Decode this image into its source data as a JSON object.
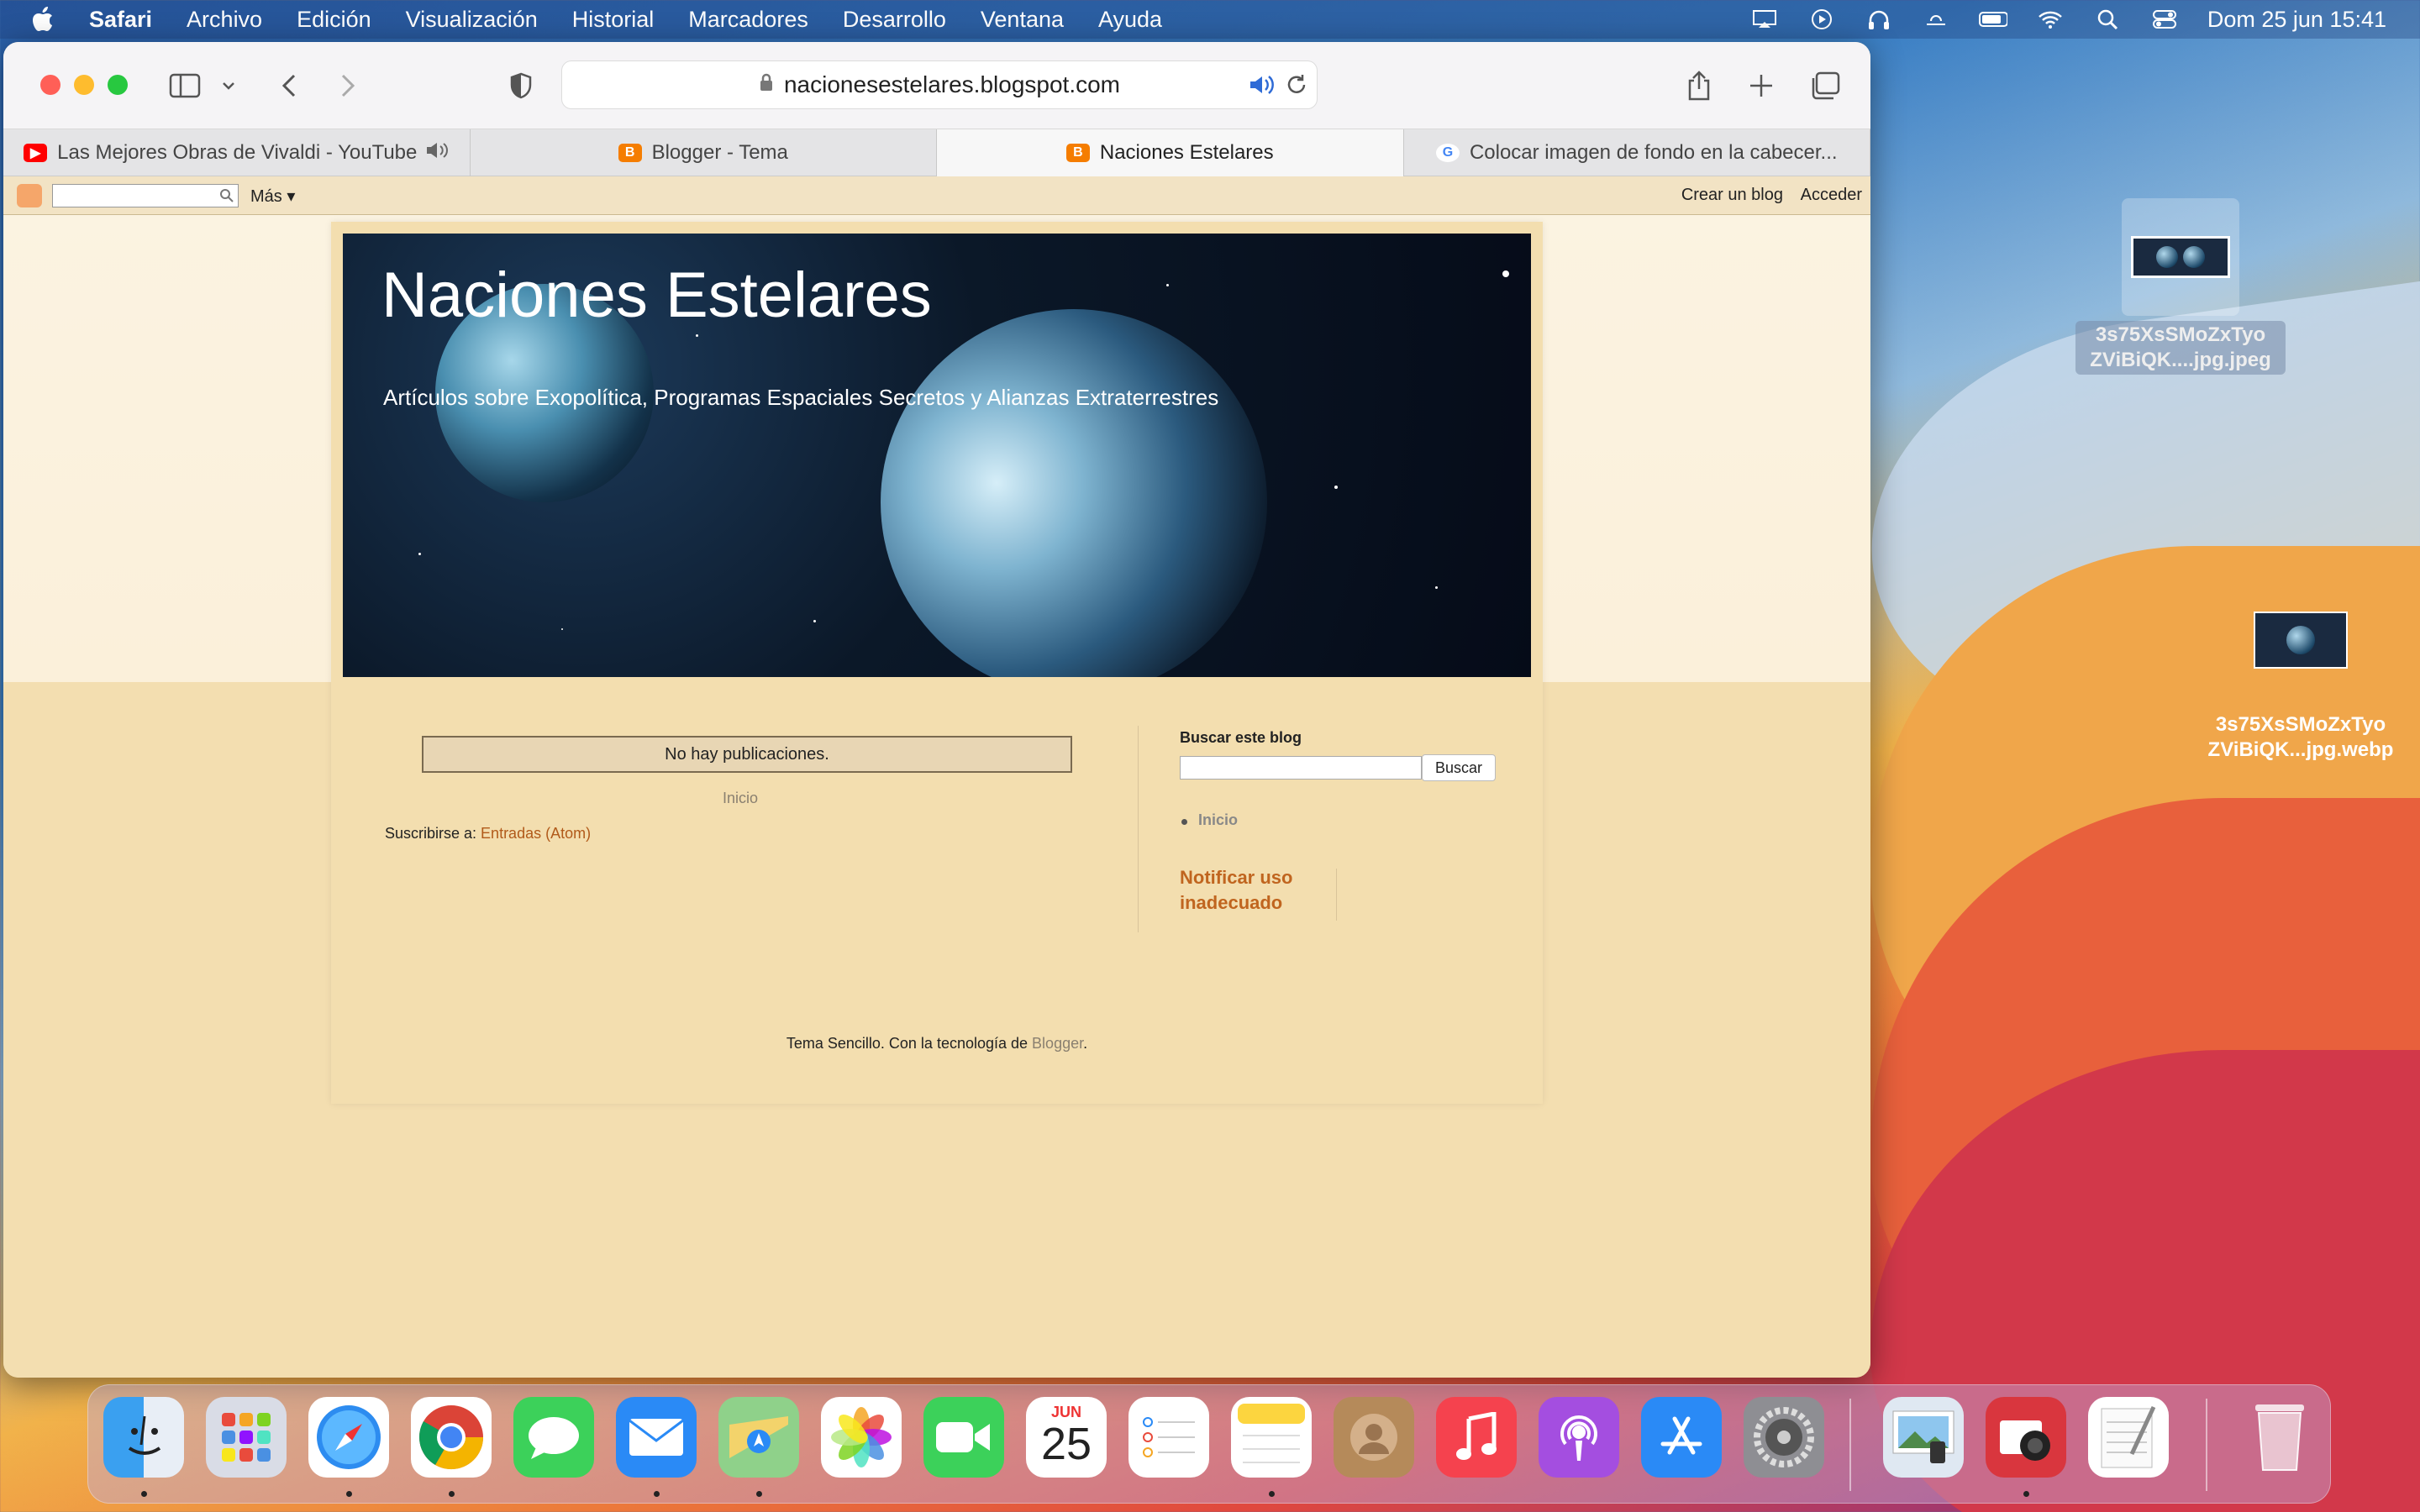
{
  "menubar": {
    "app_name": "Safari",
    "items": [
      "Archivo",
      "Edición",
      "Visualización",
      "Historial",
      "Marcadores",
      "Desarrollo",
      "Ventana",
      "Ayuda"
    ],
    "datetime": "Dom 25 jun 15:41"
  },
  "browser": {
    "url": "nacionesestelares.blogspot.com",
    "tabs": [
      {
        "title": "Las Mejores Obras de Vivaldi - YouTube",
        "favicon": "youtube-icon",
        "color": "#ff0000",
        "audio": true
      },
      {
        "title": "Blogger - Tema",
        "favicon": "blogger-icon",
        "color": "#f57d00"
      },
      {
        "title": "Naciones Estelares",
        "favicon": "blogger-icon",
        "color": "#f57d00",
        "active": true
      },
      {
        "title": "Colocar imagen de fondo en la cabecer...",
        "favicon": "google-icon",
        "color": "#4285f4"
      }
    ]
  },
  "blogger_navbar": {
    "more_label": "Más",
    "create_blog": "Crear un blog",
    "sign_in": "Acceder"
  },
  "blog": {
    "title": "Naciones Estelares",
    "description": "Artículos sobre Exopolítica, Programas Espaciales Secretos y Alianzas Extraterrestres",
    "no_posts": "No hay publicaciones.",
    "home_link": "Inicio",
    "subscribe_label": "Suscribirse a: ",
    "subscribe_link": "Entradas (Atom)",
    "sidebar": {
      "search_title": "Buscar este blog",
      "search_button": "Buscar",
      "pages": [
        "Inicio"
      ],
      "report_link": "Notificar uso inadecuado"
    },
    "footer_text": "Tema Sencillo. Con la tecnología de ",
    "footer_link": "Blogger",
    "footer_end": "."
  },
  "desktop": {
    "files": [
      {
        "name_line1": "3s75XsSMoZxTyo",
        "name_line2": "ZViBiQK....jpg.jpeg"
      },
      {
        "name_line1": "3s75XsSMoZxTyo",
        "name_line2": "ZViBiQK...jpg.webp"
      }
    ]
  },
  "dock": {
    "calendar_month": "JUN",
    "calendar_day": "25",
    "apps": [
      "finder",
      "launchpad",
      "safari",
      "chrome",
      "messages",
      "mail",
      "maps",
      "photos",
      "facetime",
      "calendar",
      "reminders",
      "notes",
      "contacts",
      "music",
      "podcasts",
      "app-store",
      "system-preferences",
      "preview",
      "photo-booth",
      "textedit",
      "trash"
    ]
  },
  "colors": {
    "page_background": "#f3deb0",
    "link_orange": "#c0651f",
    "blogger_orange": "#f57d00"
  }
}
